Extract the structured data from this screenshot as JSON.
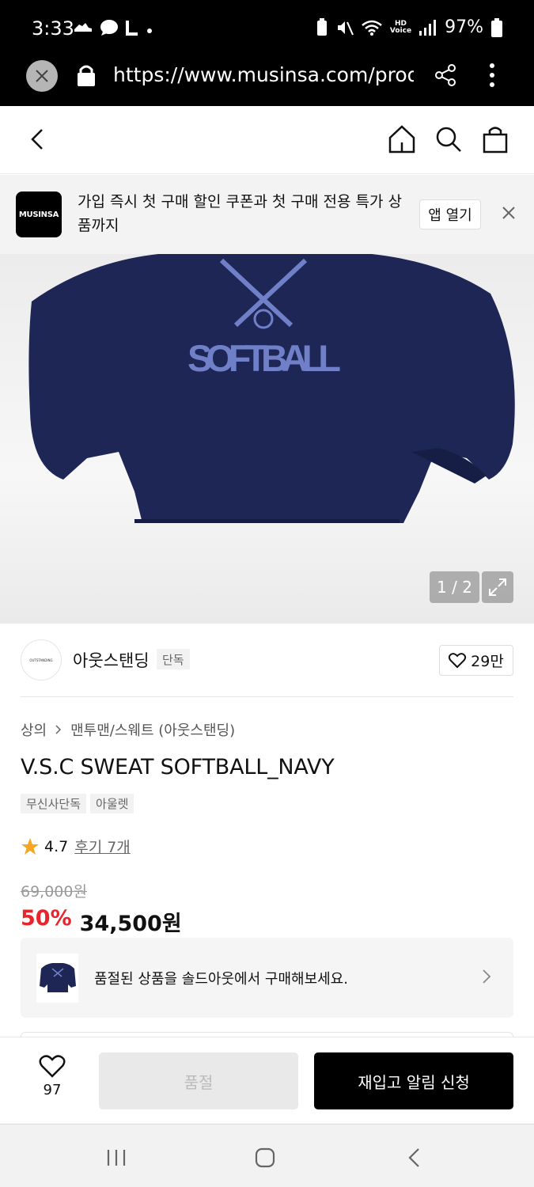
{
  "status_bar": {
    "time": "3:33",
    "battery": "97%"
  },
  "browser": {
    "url": "https://www.musinsa.com/produ"
  },
  "banner": {
    "logo_text": "MUSINSA",
    "text": "가입 즉시 첫 구매 할인 쿠폰과 첫 구매 전용 특가 상품까지",
    "open_app_label": "앱 열기"
  },
  "gallery": {
    "counter": "1 / 2",
    "print_text": "SOFTBALL"
  },
  "brand": {
    "logo_text": "OUTSTANDING",
    "name": "아웃스탠딩",
    "tag": "단독",
    "likes": "29만"
  },
  "product": {
    "breadcrumb": [
      "상의",
      "맨투맨/스웨트 (아웃스탠딩)"
    ],
    "title": "V.S.C SWEAT SOFTBALL_NAVY",
    "tags": [
      "무신사단독",
      "아울렛"
    ],
    "rating": "4.7",
    "review_label": "후기 7개",
    "original_price": "69,000원",
    "discount": "50%",
    "price": "34,500원"
  },
  "soldout_card": {
    "text": "품절된 상품을 솔드아웃에서 구매해보세요."
  },
  "bottom_bar": {
    "wish_count": "97",
    "soldout_label": "품절",
    "restock_label": "재입고 알림 신청"
  },
  "colors": {
    "accent_red": "#e8242c",
    "navy": "#1e2655",
    "black": "#000000"
  }
}
